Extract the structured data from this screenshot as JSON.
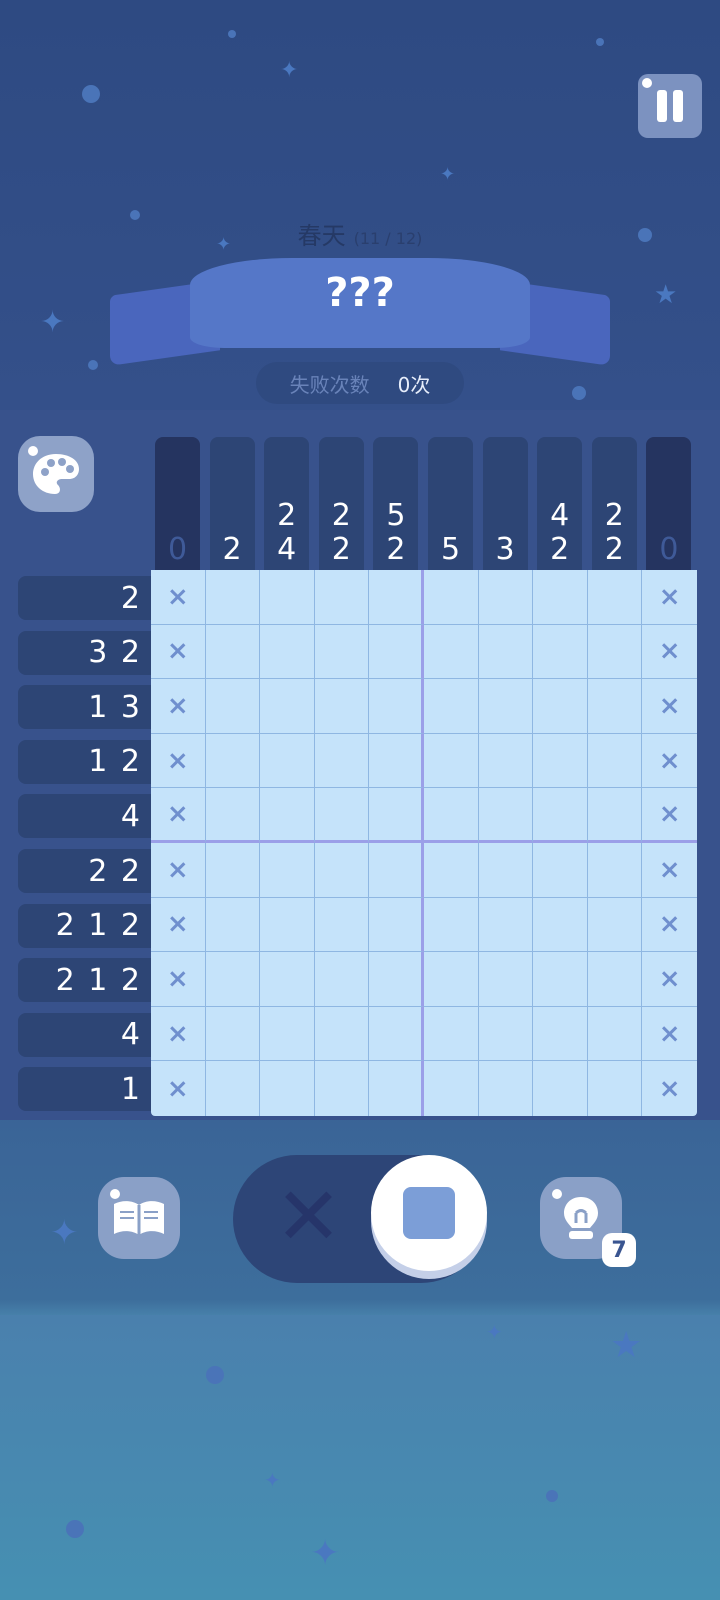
{
  "header": {
    "season_name": "春天",
    "level_progress": "(11 / 12)",
    "puzzle_title": "???",
    "fail_label": "失败次数",
    "fail_value": "0次"
  },
  "column_clues": [
    [
      "0"
    ],
    [
      "2"
    ],
    [
      "2",
      "4"
    ],
    [
      "2",
      "2"
    ],
    [
      "5",
      "2"
    ],
    [
      "5"
    ],
    [
      "3"
    ],
    [
      "4",
      "2"
    ],
    [
      "2",
      "2"
    ],
    [
      "0"
    ]
  ],
  "column_completed": [
    true,
    false,
    false,
    false,
    false,
    false,
    false,
    false,
    false,
    true
  ],
  "row_clues": [
    "2",
    "3 2",
    "1 3",
    "1 2",
    "4",
    "2 2",
    "2 1 2",
    "2 1 2",
    "4",
    "1"
  ],
  "grid": {
    "rows": 10,
    "cols": 10,
    "marked_symbol": "×",
    "marked_columns": [
      0,
      9
    ]
  },
  "toolbar": {
    "book_icon": "book-icon",
    "mode_cross_symbol": "✕",
    "mode_fill_icon": "square-icon",
    "hint_icon": "lightbulb-icon",
    "hint_count": "7"
  },
  "colors": {
    "grid_bg": "#c5e3fa",
    "clue_bg": "#2d4575",
    "accent": "#7c9ed7"
  }
}
